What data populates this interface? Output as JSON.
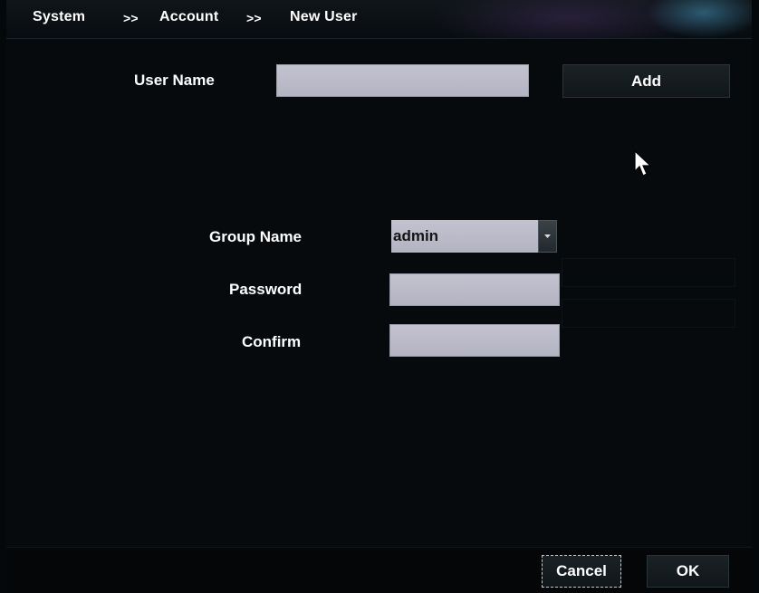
{
  "breadcrumb": {
    "items": [
      "System",
      "Account",
      "New User"
    ],
    "separator": ">>"
  },
  "user_name": {
    "label": "User Name",
    "value": "",
    "add_label": "Add"
  },
  "group_name": {
    "label": "Group Name",
    "selected": "admin"
  },
  "password": {
    "label": "Password",
    "value": ""
  },
  "confirm": {
    "label": "Confirm",
    "value": ""
  },
  "footer": {
    "cancel_label": "Cancel",
    "ok_label": "OK"
  },
  "colors": {
    "background": "#060a0d",
    "input_fill": "#bdbcca",
    "text": "#ffffff"
  }
}
